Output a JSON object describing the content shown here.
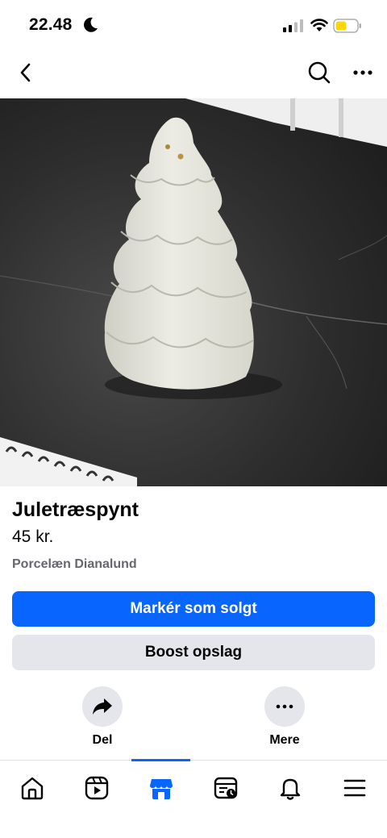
{
  "status_bar": {
    "time": "22.48",
    "battery_color": "#ffd60a"
  },
  "nav": {
    "back_icon": "chevron-left-icon",
    "search_icon": "search-icon",
    "more_icon": "more-horizontal-icon"
  },
  "listing": {
    "title": "Juletræspynt",
    "price": "45 kr.",
    "location": "Porcelæn Dianalund",
    "photo_subject": "porcelain christmas tree ornament"
  },
  "buttons": {
    "mark_sold": "Markér som solgt",
    "boost": "Boost opslag"
  },
  "actions": {
    "share_label": "Del",
    "more_label": "Mere"
  },
  "tab_bar": {
    "active_tab": "marketplace",
    "tabs": [
      "home",
      "video",
      "marketplace",
      "feeds",
      "notifications",
      "menu"
    ]
  },
  "colors": {
    "primary": "#0866ff",
    "secondary_bg": "#e4e6eb",
    "muted_text": "#65676b"
  }
}
